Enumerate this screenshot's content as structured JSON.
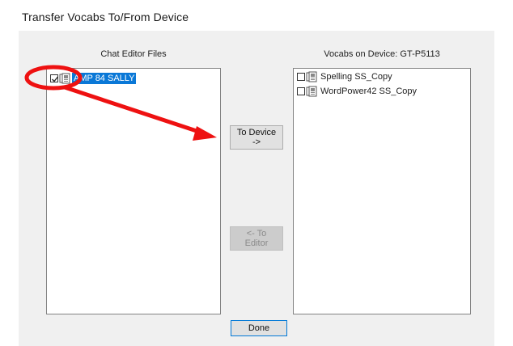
{
  "window": {
    "title": "Transfer Vocabs To/From Device"
  },
  "editor_panel": {
    "label": "Chat Editor Files",
    "items": [
      {
        "label": "AMP 84 SALLY",
        "checked": true,
        "selected": true
      }
    ]
  },
  "device_panel": {
    "label": "Vocabs on Device: GT-P5113",
    "items": [
      {
        "label": "Spelling SS_Copy",
        "checked": false
      },
      {
        "label": "WordPower42 SS_Copy",
        "checked": false
      }
    ]
  },
  "buttons": {
    "to_device": "To Device ->",
    "to_editor": "<- To Editor",
    "done": "Done"
  },
  "annotation": {
    "color": "#ee1111"
  }
}
